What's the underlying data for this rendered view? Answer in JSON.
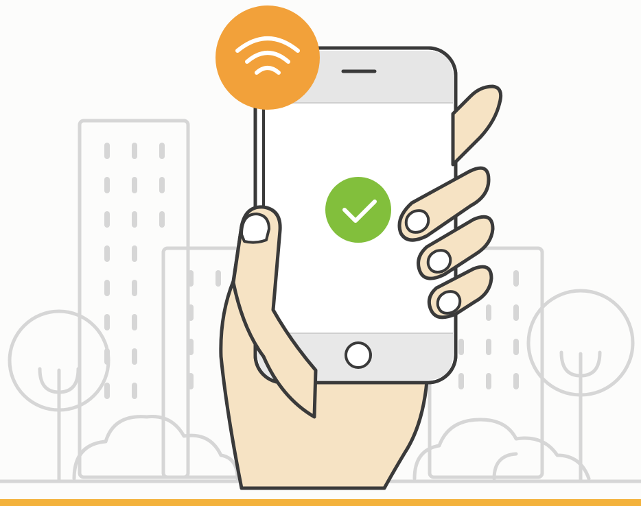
{
  "illustration": {
    "wifi_badge": {
      "icon": "wifi-icon",
      "color": "#f2a13a"
    },
    "phone_status": {
      "icon": "check-icon",
      "color": "#82bf3c"
    },
    "skin_color": "#f6e3c4",
    "outline_color": "#3a3a3a",
    "city_line_color": "#d6d6d6",
    "accent_bar_color": "#f3b23c"
  }
}
